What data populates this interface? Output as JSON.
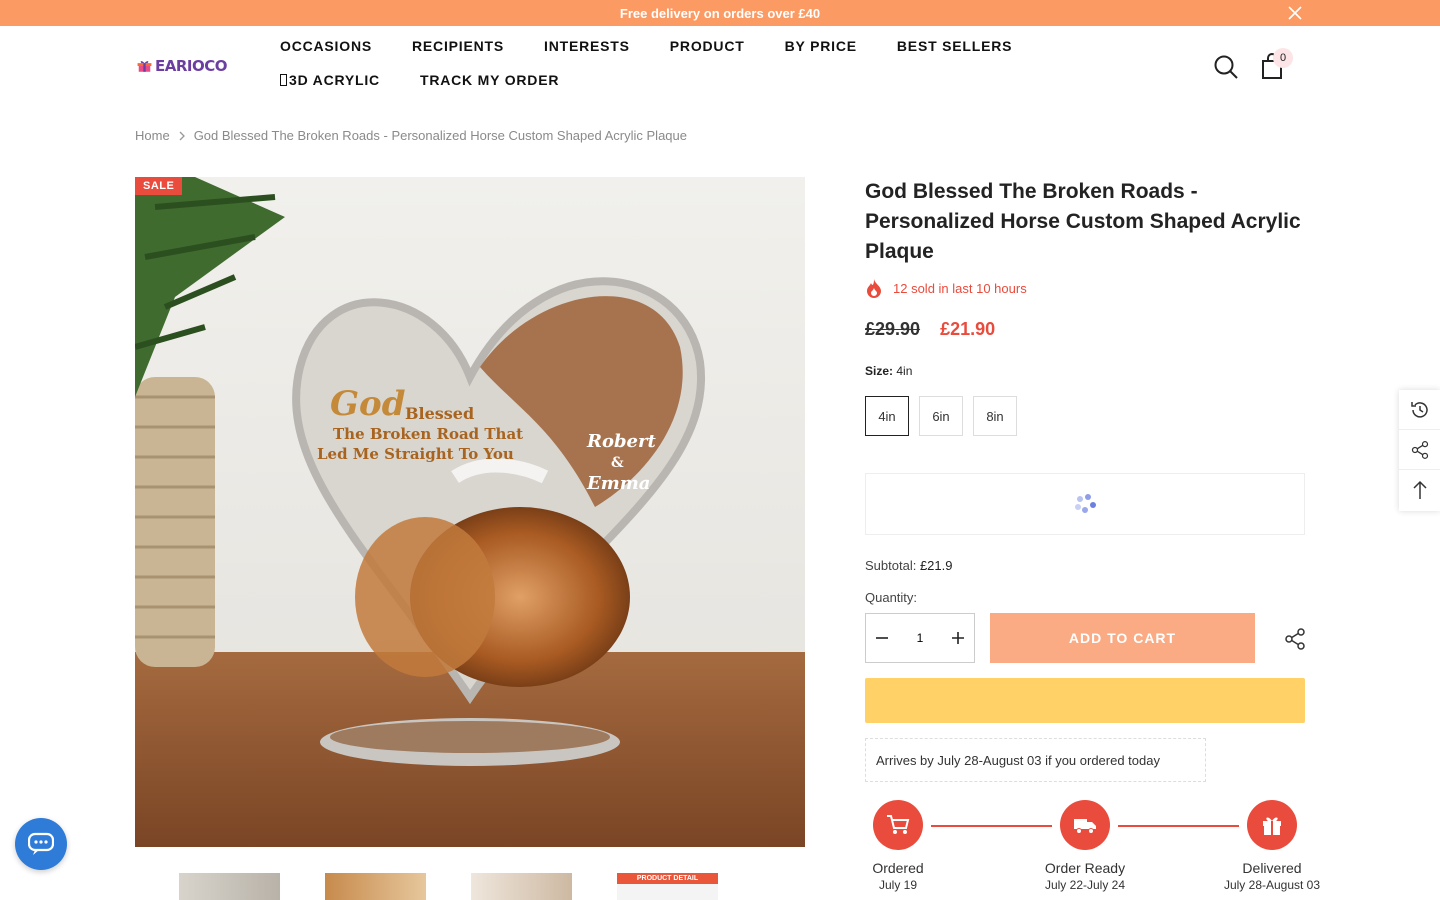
{
  "announcement": {
    "text": "Free delivery on orders over £40"
  },
  "header": {
    "logo_text": "EARIOCO",
    "nav": [
      "OCCASIONS",
      "RECIPIENTS",
      "INTERESTS",
      "PRODUCT",
      "BY PRICE",
      "BEST SELLERS",
      "3D ACRYLIC",
      "TRACK MY ORDER"
    ],
    "cart_count": "0"
  },
  "breadcrumb": {
    "home": "Home",
    "current": "God Blessed The Broken Roads - Personalized Horse Custom Shaped Acrylic Plaque"
  },
  "gallery": {
    "sale_badge": "SALE",
    "plaque_text": {
      "line1a": "God",
      "line1b": "Blessed",
      "line2": "The Broken Road That",
      "line3": "Led Me Straight To You",
      "name1": "Robert",
      "amp": "&",
      "name2": "Emma"
    },
    "thumb_label": "PRODUCT DETAIL"
  },
  "product": {
    "title": "God Blessed The Broken Roads - Personalized Horse Custom Shaped Acrylic Plaque",
    "sold_text": "12 sold in last 10 hours",
    "price_old": "£29.90",
    "price_new": "£21.90",
    "size_label": "Size:",
    "size_value": "4in",
    "sizes": [
      "4in",
      "6in",
      "8in"
    ],
    "subtotal_label": "Subtotal:",
    "subtotal_value": "£21.9",
    "quantity_label": "Quantity:",
    "quantity_value": "1",
    "add_to_cart": "ADD TO CART",
    "arrives": "Arrives by July 28-August 03 if you ordered today"
  },
  "timeline": [
    {
      "label": "Ordered",
      "date": "July 19"
    },
    {
      "label": "Order Ready",
      "date": "July 22-July 24"
    },
    {
      "label": "Delivered",
      "date": "July 28-August 03"
    }
  ],
  "colors": {
    "accent": "#e94b3c",
    "announce_bg": "#fb9a63",
    "cart_button": "#fbab84",
    "buy_now": "#ffd166",
    "chat": "#2e7bd8"
  }
}
